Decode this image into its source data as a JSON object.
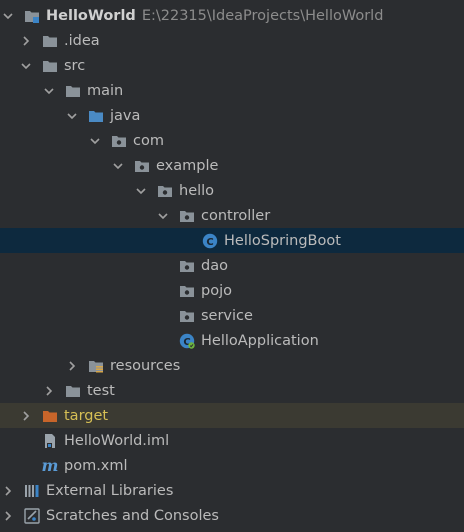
{
  "project": {
    "name": "HelloWorld",
    "path": "E:\\22315\\IdeaProjects\\HelloWorld"
  },
  "tree": {
    "idea": ".idea",
    "src": "src",
    "main": "main",
    "java": "java",
    "com": "com",
    "example": "example",
    "hello": "hello",
    "controller": "controller",
    "hello_spring_boot": "HelloSpringBoot",
    "dao": "dao",
    "pojo": "pojo",
    "service": "service",
    "hello_application": "HelloApplication",
    "resources": "resources",
    "test": "test",
    "target": "target",
    "iml_file": "HelloWorld.iml",
    "pom_file": "pom.xml",
    "external_libraries": "External Libraries",
    "scratches": "Scratches and Consoles"
  },
  "icons": {
    "folder": "folder-icon",
    "package": "package-icon",
    "source_root": "source-root-folder-icon",
    "resources_root": "resources-root-folder-icon",
    "excluded": "excluded-folder-icon",
    "class": "class-icon",
    "spring_app": "spring-boot-application-icon",
    "iml": "iml-file-icon",
    "maven": "maven-pom-icon",
    "libraries": "external-libraries-icon",
    "scratches": "scratches-icon"
  },
  "colors": {
    "background": "#2b2d30",
    "selection": "#0d293e",
    "excluded_row": "#3b3a32",
    "text": "#bbbbbb",
    "path_text": "#8c8c8c",
    "folder": "#8a9299",
    "source_folder": "#4a8ac4",
    "excluded_folder": "#c8652a",
    "class_badge": "#3b84c6"
  }
}
